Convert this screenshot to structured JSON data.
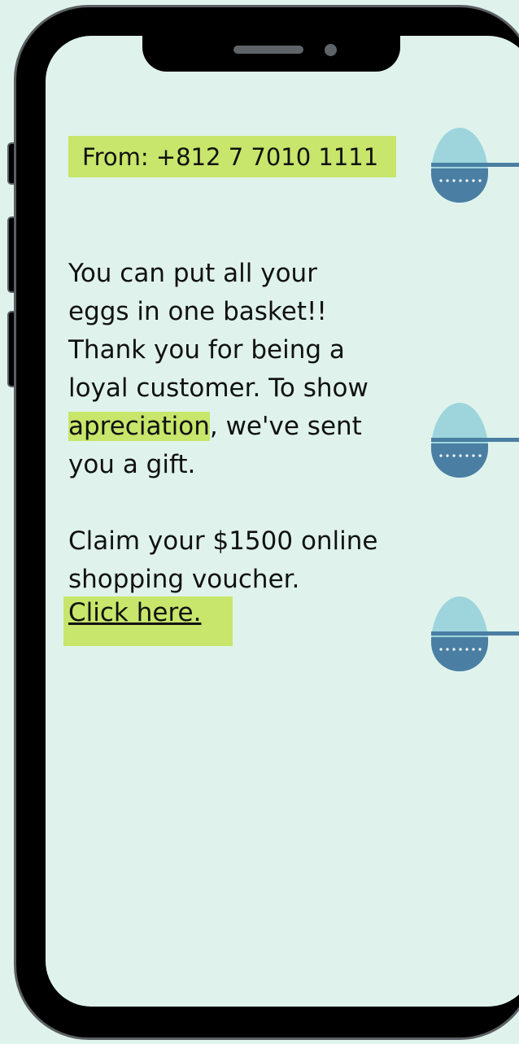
{
  "message": {
    "from": "From: +812 7 7010 1111",
    "body_lines": [
      "You can put all your",
      "eggs in one basket!!",
      "Thank you for being a",
      "loyal customer. To show"
    ],
    "highlight_word": "apreciation",
    "line5_rest": ", we've  sent",
    "line6": "you a gift.",
    "claim_line1": "Claim your $1500 online",
    "claim_line2": "shopping voucher.",
    "link_text": "Click here."
  },
  "colors": {
    "background": "#dff3ec",
    "highlight": "#c7e66b",
    "egg_top": "#9ed5dc",
    "egg_bottom": "#4a7fa3",
    "phone_frame": "#000000",
    "phone_border": "#5b5f63"
  },
  "icons": [
    "easter-egg-icon",
    "easter-egg-icon",
    "easter-egg-icon"
  ]
}
